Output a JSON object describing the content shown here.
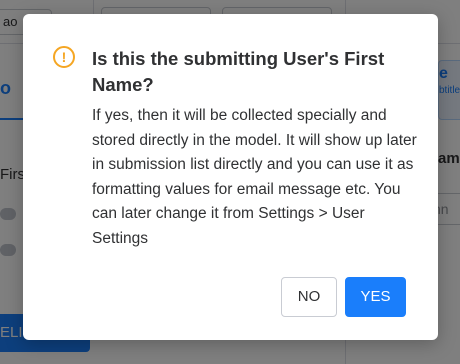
{
  "background": {
    "top_input_left": "ao",
    "left_tab_label": "o",
    "field_label": "First",
    "bottom_button_label": "ELI",
    "right_panel_title": "e",
    "right_panel_subtitle": "btitle",
    "right_header": "am",
    "right_input_placeholder": "hn"
  },
  "dialog": {
    "icon": "warning-circle-icon",
    "icon_glyph": "!",
    "title": "Is this the submitting User's First Name?",
    "message": "If yes, then it will be collected specially and stored directly in the model. It will show up later in submission list directly and you can use it as formatting values for email message etc. You can later change it from Settings > User Settings",
    "no_label": "NO",
    "yes_label": "YES"
  },
  "colors": {
    "primary": "#1a7efb",
    "warning": "#f5a623",
    "text": "#303133"
  }
}
